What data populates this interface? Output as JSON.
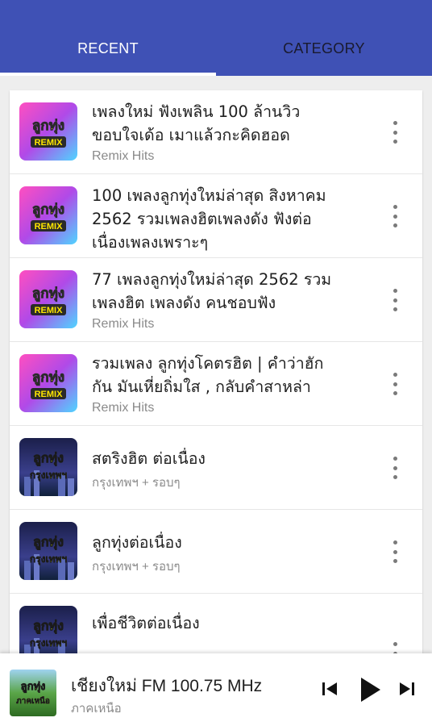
{
  "tabs": [
    {
      "label": "RECENT",
      "active": true
    },
    {
      "label": "CATEGORY",
      "active": false
    }
  ],
  "colors": {
    "appbar": "#3f51b5",
    "indicator": "#ffffff"
  },
  "items": [
    {
      "title_lines": [
        "เพลงใหม่ ฟังเพลิน 100 ล้านวิว",
        "ขอบใจเด้อ เมาแล้วกะคิดฮอด"
      ],
      "subtitle": "Remix Hits",
      "thumb": "ลูกทุ่ง REMIX"
    },
    {
      "title_lines": [
        "100 เพลงลูกทุ่งใหม่ล่าสุด สิงหาคม",
        "2562 รวมเพลงฮิตเพลงดัง ฟังต่อ",
        "เนื่องเพลงเพราะๆ"
      ],
      "subtitle": "",
      "thumb": "ลูกทุ่ง REMIX"
    },
    {
      "title_lines": [
        "77 เพลงลูกทุ่งใหม่ล่าสุด 2562 รวม",
        "เพลงฮิต เพลงดัง คนชอบฟัง"
      ],
      "subtitle": "Remix Hits",
      "thumb": "ลูกทุ่ง REMIX"
    },
    {
      "title_lines": [
        "รวมเพลง ลูกทุ่งโคตรฮิต | คำว่าฮัก",
        "กัน มันเหี่ยถิ่มใส , กลับคำสาหล่า"
      ],
      "subtitle": "Remix Hits",
      "thumb": "ลูกทุ่ง REMIX"
    },
    {
      "title_lines": [
        "สตริงฮิต ต่อเนื่อง"
      ],
      "subtitle": "กรุงเทพฯ + รอบๆ",
      "thumb": "ลูกทุ่ง กรุงเทพฯ"
    },
    {
      "title_lines": [
        "ลูกทุ่งต่อเนื่อง"
      ],
      "subtitle": "กรุงเทพฯ + รอบๆ",
      "thumb": "ลูกทุ่ง กรุงเทพฯ"
    },
    {
      "title_lines": [
        "เพื่อชีวิตต่อเนื่อง"
      ],
      "subtitle": "",
      "thumb": "ลูกทุ่ง กรุงเทพฯ"
    }
  ],
  "now_playing": {
    "title": "เชียงใหม่ FM 100.75 MHz",
    "subtitle": "ภาคเหนือ",
    "thumb": "ลูกทุ่ง ภาคเหนือ"
  },
  "icons": {
    "more": "more-vert-icon",
    "prev": "skip-previous-icon",
    "play": "play-icon",
    "next": "skip-next-icon"
  }
}
